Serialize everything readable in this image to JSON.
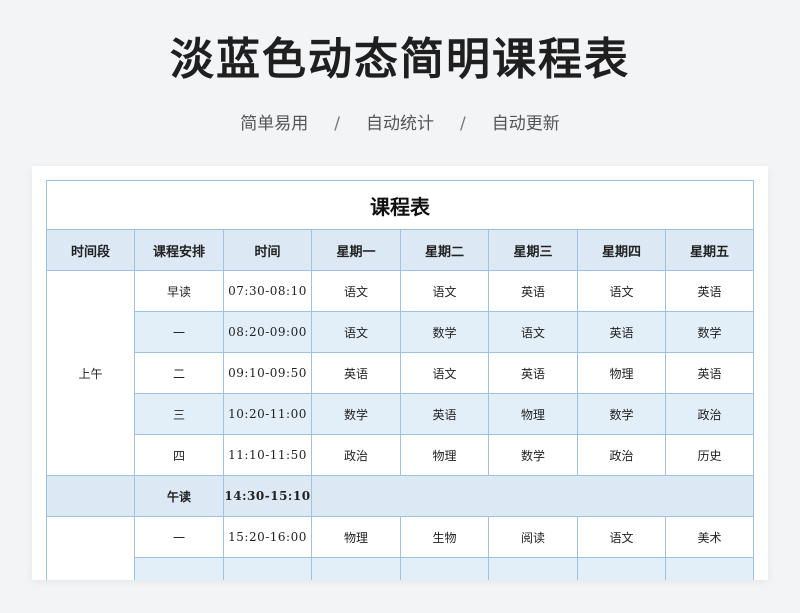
{
  "hero": {
    "title": "淡蓝色动态简明课程表",
    "tags": [
      "简单易用",
      "自动统计",
      "自动更新"
    ],
    "separator": "/"
  },
  "table": {
    "title": "课程表",
    "headers": [
      "时间段",
      "课程安排",
      "时间",
      "星期一",
      "星期二",
      "星期三",
      "星期四",
      "星期五"
    ],
    "morning": {
      "period": "上午",
      "rows": [
        {
          "slot": "早读",
          "time": "07:30-08:10",
          "days": [
            "语文",
            "语文",
            "英语",
            "语文",
            "英语"
          ]
        },
        {
          "slot": "一",
          "time": "08:20-09:00",
          "days": [
            "语文",
            "数学",
            "语文",
            "英语",
            "数学"
          ]
        },
        {
          "slot": "二",
          "time": "09:10-09:50",
          "days": [
            "英语",
            "语文",
            "英语",
            "物理",
            "英语"
          ]
        },
        {
          "slot": "三",
          "time": "10:20-11:00",
          "days": [
            "数学",
            "英语",
            "物理",
            "数学",
            "政治"
          ]
        },
        {
          "slot": "四",
          "time": "11:10-11:50",
          "days": [
            "政治",
            "物理",
            "数学",
            "政治",
            "历史"
          ]
        }
      ]
    },
    "noon": {
      "slot": "午读",
      "time": "14:30-15:10"
    },
    "afternoon": {
      "period": "",
      "rows": [
        {
          "slot": "一",
          "time": "15:20-16:00",
          "days": [
            "物理",
            "生物",
            "阅读",
            "语文",
            "美术"
          ]
        },
        {
          "slot": "",
          "time": "",
          "days": [
            "",
            "",
            "",
            "",
            ""
          ]
        }
      ]
    }
  },
  "colors": {
    "background": "#f3f4f6",
    "grid": "#9cc3e4",
    "header_fill": "#dce9f5",
    "alt_row_fill": "#e2eef8"
  }
}
